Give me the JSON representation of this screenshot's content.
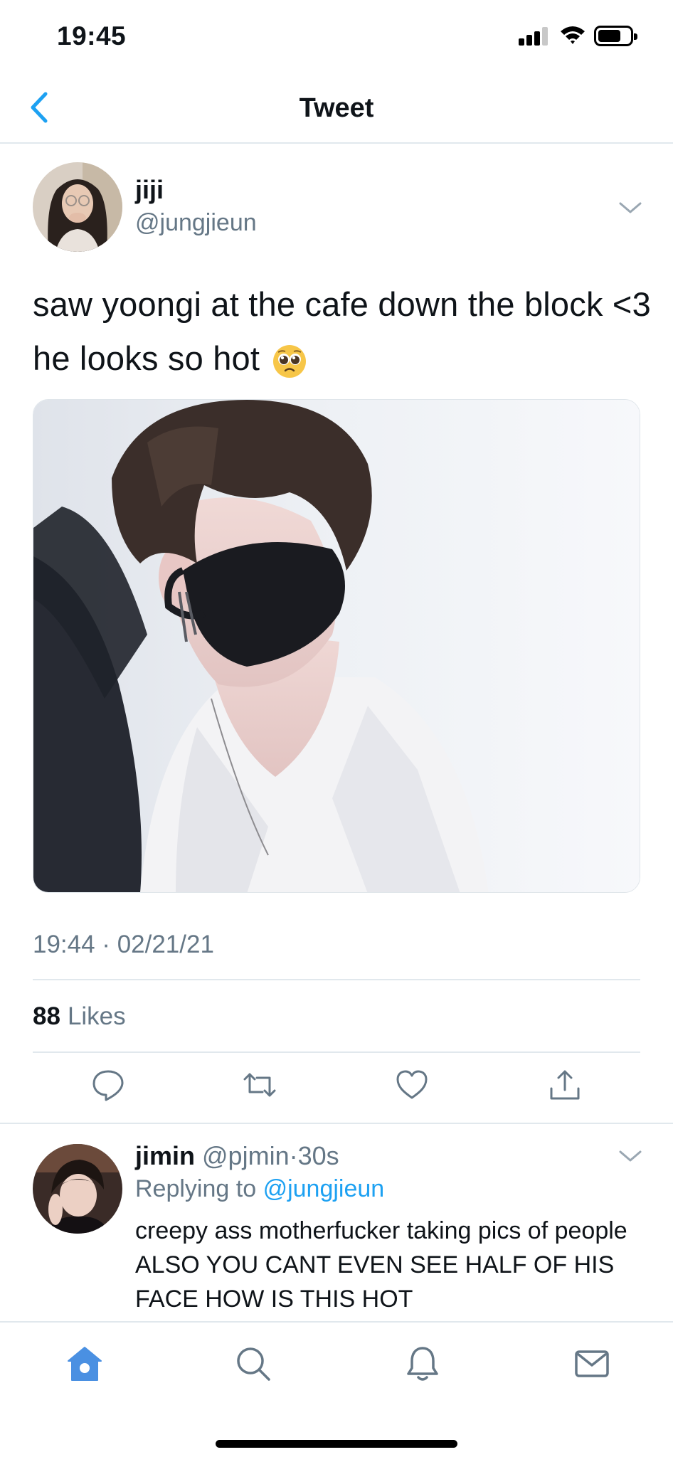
{
  "status_bar": {
    "time": "19:45"
  },
  "nav": {
    "title": "Tweet"
  },
  "tweet": {
    "display_name": "jiji",
    "handle": "@jungjieun",
    "text": "saw yoongi at the cafe down the block <3 he looks so hot",
    "emoji": "pleading-face",
    "timestamp": "19:44 · 02/21/21",
    "likes_count": "88",
    "likes_label": "Likes"
  },
  "reply": {
    "display_name": "jimin",
    "handle": "@pjmin",
    "separator": "·",
    "age": "30s",
    "replying_prefix": "Replying to",
    "replying_to": "@jungjieun",
    "text": "creepy ass motherfucker taking pics of people ALSO YOU CANT EVEN SEE HALF OF HIS FACE HOW IS THIS HOT"
  },
  "icons": {
    "back": "chevron-left-icon",
    "menu": "chevron-down-icon",
    "actions": [
      "reply-icon",
      "retweet-icon",
      "like-icon",
      "share-icon"
    ],
    "tabs": [
      "home-icon",
      "search-icon",
      "notifications-icon",
      "messages-icon"
    ]
  },
  "colors": {
    "accent": "#1da1f2",
    "tab_active": "#4a90e2",
    "secondary_text": "#657786",
    "divider": "#e1e8ed"
  }
}
